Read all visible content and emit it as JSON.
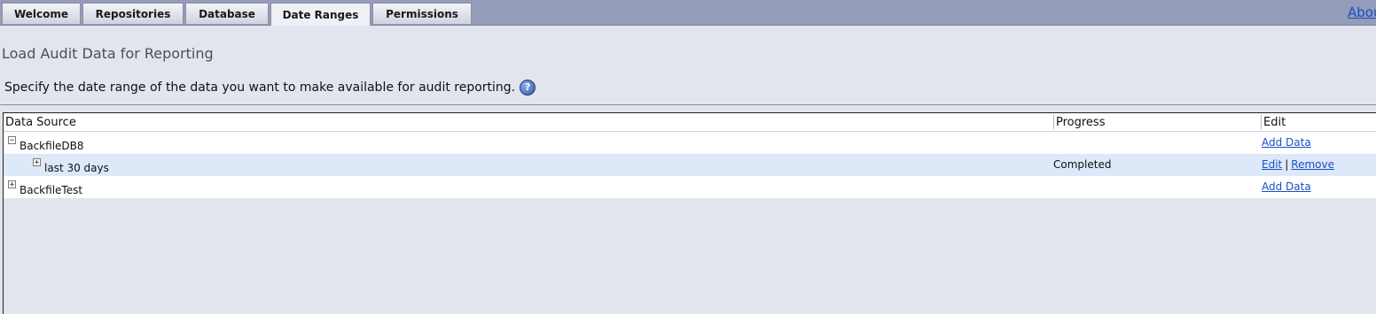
{
  "tabs": {
    "welcome": "Welcome",
    "repositories": "Repositories",
    "database": "Database",
    "date_ranges": "Date Ranges",
    "permissions": "Permissions"
  },
  "about_link": "About",
  "page_title": "Load Audit Data for Reporting",
  "instructions": "Specify the date range of the data you want to make available for audit reporting.",
  "help_icon": "question-icon",
  "grid": {
    "columns": {
      "data_source": "Data Source",
      "progress": "Progress",
      "edit": "Edit"
    },
    "rows": [
      {
        "name": "BackfileDB8",
        "expander": "−",
        "progress": "",
        "action": "Add Data"
      },
      {
        "name": "last 30 days",
        "expander": "+",
        "progress": "Completed",
        "edit": "Edit",
        "separator": "|",
        "remove": "Remove"
      },
      {
        "name": "BackfileTest",
        "expander": "+",
        "progress": "",
        "action": "Add Data"
      }
    ]
  },
  "colors": {
    "tabbar": "#949cb9",
    "page_bg": "#e2e5ee",
    "link": "#1a4fc4",
    "selected_row": "#dde8f8"
  }
}
